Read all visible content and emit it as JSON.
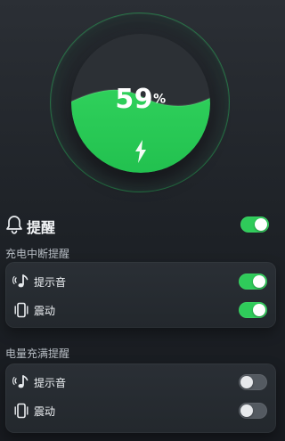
{
  "battery": {
    "percent_value": "59",
    "percent_unit": "%",
    "level": 0.59
  },
  "reminder": {
    "title": "提醒",
    "enabled": true
  },
  "charging_interrupt": {
    "title": "充电中断提醒",
    "items": [
      {
        "label": "提示音",
        "enabled": true,
        "icon": "sound-icon"
      },
      {
        "label": "震动",
        "enabled": true,
        "icon": "vibrate-icon"
      }
    ]
  },
  "full_charge": {
    "title": "电量充满提醒",
    "items": [
      {
        "label": "提示音",
        "enabled": false,
        "icon": "sound-icon"
      },
      {
        "label": "震动",
        "enabled": false,
        "icon": "vibrate-icon"
      }
    ]
  },
  "colors": {
    "accent_green": "#2fcb5a",
    "bg": "#1d2126"
  }
}
